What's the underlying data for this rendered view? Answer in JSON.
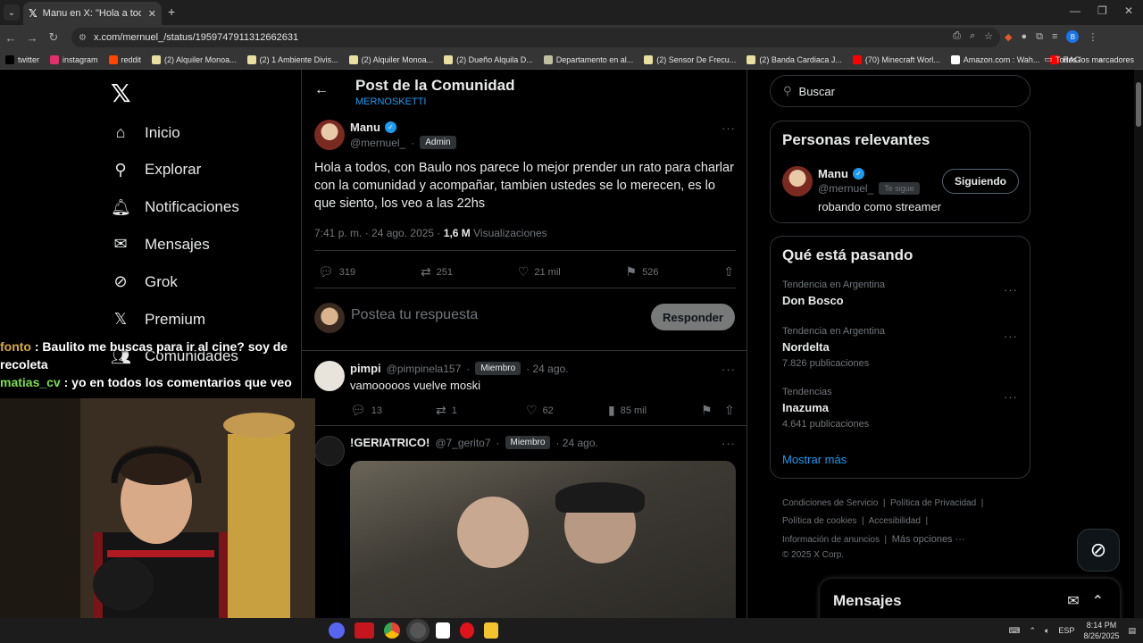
{
  "browser": {
    "tab_title": "Manu en X: \"Hola a todos, con B",
    "url": "x.com/mernuel_/status/1959747911312662631",
    "bookmarks": [
      {
        "label": "twitter",
        "color": "#000000"
      },
      {
        "label": "instagram",
        "color": "#e1306c"
      },
      {
        "label": "reddit",
        "color": "#ff4500"
      },
      {
        "label": "(2) Alquiler Monoa...",
        "color": "#e8e0a0"
      },
      {
        "label": "(2) 1 Ambiente Divis...",
        "color": "#e8e0a0"
      },
      {
        "label": "(2) Alquiler Monoa...",
        "color": "#e8e0a0"
      },
      {
        "label": "(2) Dueño Alquila D...",
        "color": "#e8e0a0"
      },
      {
        "label": "Departamento en al...",
        "color": "#c0c0a0"
      },
      {
        "label": "(2) Sensor De Frecu...",
        "color": "#e8e0a0"
      },
      {
        "label": "(2) Banda Cardiaca J...",
        "color": "#e8e0a0"
      },
      {
        "label": "(70) Minecraft Worl...",
        "color": "#ff0000"
      },
      {
        "label": "Amazon.com : Wah...",
        "color": "#ffffff"
      },
      {
        "label": "RAG",
        "color": "#ff0000"
      }
    ],
    "all_bookmarks": "Todos los marcadores",
    "profile_initial": "B"
  },
  "nav": {
    "items": [
      {
        "label": "Inicio",
        "icon": "home-icon"
      },
      {
        "label": "Explorar",
        "icon": "search-icon"
      },
      {
        "label": "Notificaciones",
        "icon": "bell-icon"
      },
      {
        "label": "Mensajes",
        "icon": "mail-icon"
      },
      {
        "label": "Grok",
        "icon": "grok-icon"
      },
      {
        "label": "Premium",
        "icon": "x-icon"
      },
      {
        "label": "Comunidades",
        "icon": "people-icon"
      }
    ]
  },
  "header": {
    "title": "Post de la Comunidad",
    "community": "MERNOSKETTI"
  },
  "post": {
    "name": "Manu",
    "handle": "@mernuel_",
    "badge": "Admin",
    "text": "Hola a todos, con Baulo nos parece lo mejor prender un rato para charlar con la comunidad y acompañar, tambien ustedes se lo merecen, es lo que siento, los veo a las 22hs",
    "time": "7:41 p. m. · 24 ago. 2025 · ",
    "views_count": "1,6 M",
    "views_label": "Visualizaciones",
    "replies": "319",
    "reposts": "251",
    "likes": "21 mil",
    "bookmarks": "526"
  },
  "reply_box": {
    "placeholder": "Postea tu respuesta",
    "button": "Responder"
  },
  "comments": [
    {
      "name": "pimpi",
      "handle": "@pimpinela157",
      "badge": "Miembro",
      "date": "· 24 ago.",
      "text": "vamooooos vuelve moski",
      "replies": "13",
      "reposts": "1",
      "likes": "62",
      "views": "85 mil"
    },
    {
      "name": "!GERIATRICO!",
      "handle": "@7_gerito7",
      "badge": "Miembro",
      "date": "· 24 ago."
    }
  ],
  "search": {
    "placeholder": "Buscar"
  },
  "relevant": {
    "title": "Personas relevantes",
    "name": "Manu",
    "handle": "@mernuel_",
    "follows_you": "Te sigue",
    "bio": "robando como streamer",
    "button": "Siguiendo"
  },
  "trends": {
    "title": "Qué está pasando",
    "items": [
      {
        "context": "Tendencia en Argentina",
        "name": "Don Bosco",
        "count": ""
      },
      {
        "context": "Tendencia en Argentina",
        "name": "Nordelta",
        "count": "7.826 publicaciones"
      },
      {
        "context": "Tendencias",
        "name": "Inazuma",
        "count": "4.641 publicaciones"
      }
    ],
    "show_more": "Mostrar más"
  },
  "footer": {
    "links": [
      "Condiciones de Servicio",
      "Política de Privacidad",
      "Política de cookies",
      "Accesibilidad",
      "Información de anuncios",
      "Más opciones ···"
    ],
    "copyright": "© 2025 X Corp."
  },
  "messages_drawer": {
    "title": "Mensajes"
  },
  "chat": [
    {
      "user": "fonto",
      "text": " : Baulito me buscas para ir al cine? soy de recoleta"
    },
    {
      "user": "matias_cv",
      "text": " : yo en todos los comentarios que veo"
    }
  ],
  "taskbar": {
    "lang": "ESP",
    "time": "8:14 PM",
    "date": "8/26/2025"
  }
}
